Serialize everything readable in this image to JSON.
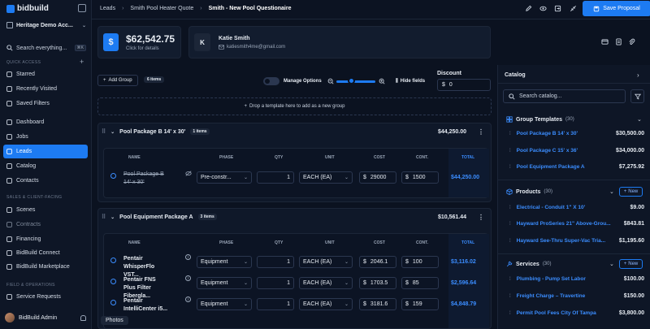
{
  "brand": {
    "name": "bidbuild",
    "accent": "#1d7bf2"
  },
  "sidebar": {
    "org": "Heritage Demo Acc...",
    "search_placeholder": "Search everything...",
    "search_kbd": "⌘K",
    "quick_access_label": "QUICK ACCESS",
    "quick_access": [
      {
        "label": "Starred"
      },
      {
        "label": "Recently Visited"
      },
      {
        "label": "Saved Filters"
      }
    ],
    "main_nav": [
      {
        "label": "Dashboard"
      },
      {
        "label": "Jobs"
      },
      {
        "label": "Leads"
      },
      {
        "label": "Catalog"
      },
      {
        "label": "Contacts"
      }
    ],
    "sales_label": "SALES & CLIENT-FACING",
    "sales_nav": [
      {
        "label": "Scenes"
      },
      {
        "label": "Contracts"
      },
      {
        "label": "Financing"
      },
      {
        "label": "BidBuild Connect"
      },
      {
        "label": "BidBuild Marketplace"
      }
    ],
    "field_label": "FIELD & OPERATIONS",
    "field_nav": [
      {
        "label": "Service Requests"
      }
    ],
    "user": "BidBuild Admin"
  },
  "header": {
    "breadcrumbs": [
      "Leads",
      "Smith Pool Heater Quote",
      "Smith - New Pool Questionaire"
    ],
    "save_label": "Save Proposal"
  },
  "summary": {
    "price": "$62,542.75",
    "price_sub": "Click for details",
    "contact_initial": "K",
    "contact_name": "Katie Smith",
    "contact_email": "katiesmith4me@gmail.com"
  },
  "toolbar": {
    "add_group": "Add Group",
    "items_count": "6 items",
    "manage_options": "Manage Options",
    "hide_fields": "Hide fields",
    "discount_label": "Discount",
    "discount_currency": "$",
    "discount_value": "0",
    "dropzone": "Drop a template here to add as a new group"
  },
  "columns": {
    "name": "NAME",
    "phase": "PHASE",
    "qty": "QTY",
    "unit": "UNIT",
    "cost": "COST",
    "cont": "CONT.",
    "total": "TOTAL"
  },
  "groups": [
    {
      "title": "Pool Package B 14' x 30'",
      "count": "1 items",
      "total": "$44,250.00",
      "rows": [
        {
          "name": "Pool Package B 14' x 30'",
          "phase": "Pre-constr...",
          "qty": "1",
          "unit": "EACH (EA)",
          "cost": "29000",
          "cont": "1500",
          "total": "$44,250.00"
        }
      ]
    },
    {
      "title": "Pool Equipment Package A",
      "count": "3 items",
      "total": "$10,561.44",
      "rows": [
        {
          "name": "Pentair WhisperFlo VST...",
          "phase": "Equipment",
          "qty": "1",
          "unit": "EACH (EA)",
          "cost": "2046.1",
          "cont": "100",
          "total": "$3,116.02"
        },
        {
          "name": "Pentair FNS Plus Filter Fibergla...",
          "phase": "Equipment",
          "qty": "1",
          "unit": "EACH (EA)",
          "cost": "1703.5",
          "cont": "85",
          "total": "$2,596.64"
        },
        {
          "name": "Pentair IntelliCenter i5...",
          "phase": "Equipment",
          "qty": "1",
          "unit": "EACH (EA)",
          "cost": "3181.6",
          "cont": "159",
          "total": "$4,848.79"
        }
      ]
    }
  ],
  "catalog": {
    "title": "Catalog",
    "search_placeholder": "Search catalog...",
    "new_label": "New",
    "sections": [
      {
        "title": "Group Templates",
        "count": "(30)",
        "items": [
          {
            "name": "Pool Package B 14' x 30'",
            "price": "$30,500.00"
          },
          {
            "name": "Pool Package C 15' x 36'",
            "price": "$34,000.00"
          },
          {
            "name": "Pool Equipment Package A",
            "price": "$7,275.92"
          }
        ]
      },
      {
        "title": "Products",
        "count": "(30)",
        "items": [
          {
            "name": "Electrical - Conduit 1\" X 10'",
            "price": "$9.00"
          },
          {
            "name": "Hayward ProSeries 21\" Above-Grou...",
            "price": "$843.81"
          },
          {
            "name": "Hayward See-Thru Super-Vac Tria...",
            "price": "$1,195.60"
          }
        ]
      },
      {
        "title": "Services",
        "count": "(30)",
        "items": [
          {
            "name": "Plumbing - Pump Set Labor",
            "price": "$100.00"
          },
          {
            "name": "Freight Charge – Travertine",
            "price": "$150.00"
          },
          {
            "name": "Permit Pool Fees City Of Tampa",
            "price": "$3,800.00"
          }
        ]
      }
    ]
  },
  "photos_label": "Photos"
}
